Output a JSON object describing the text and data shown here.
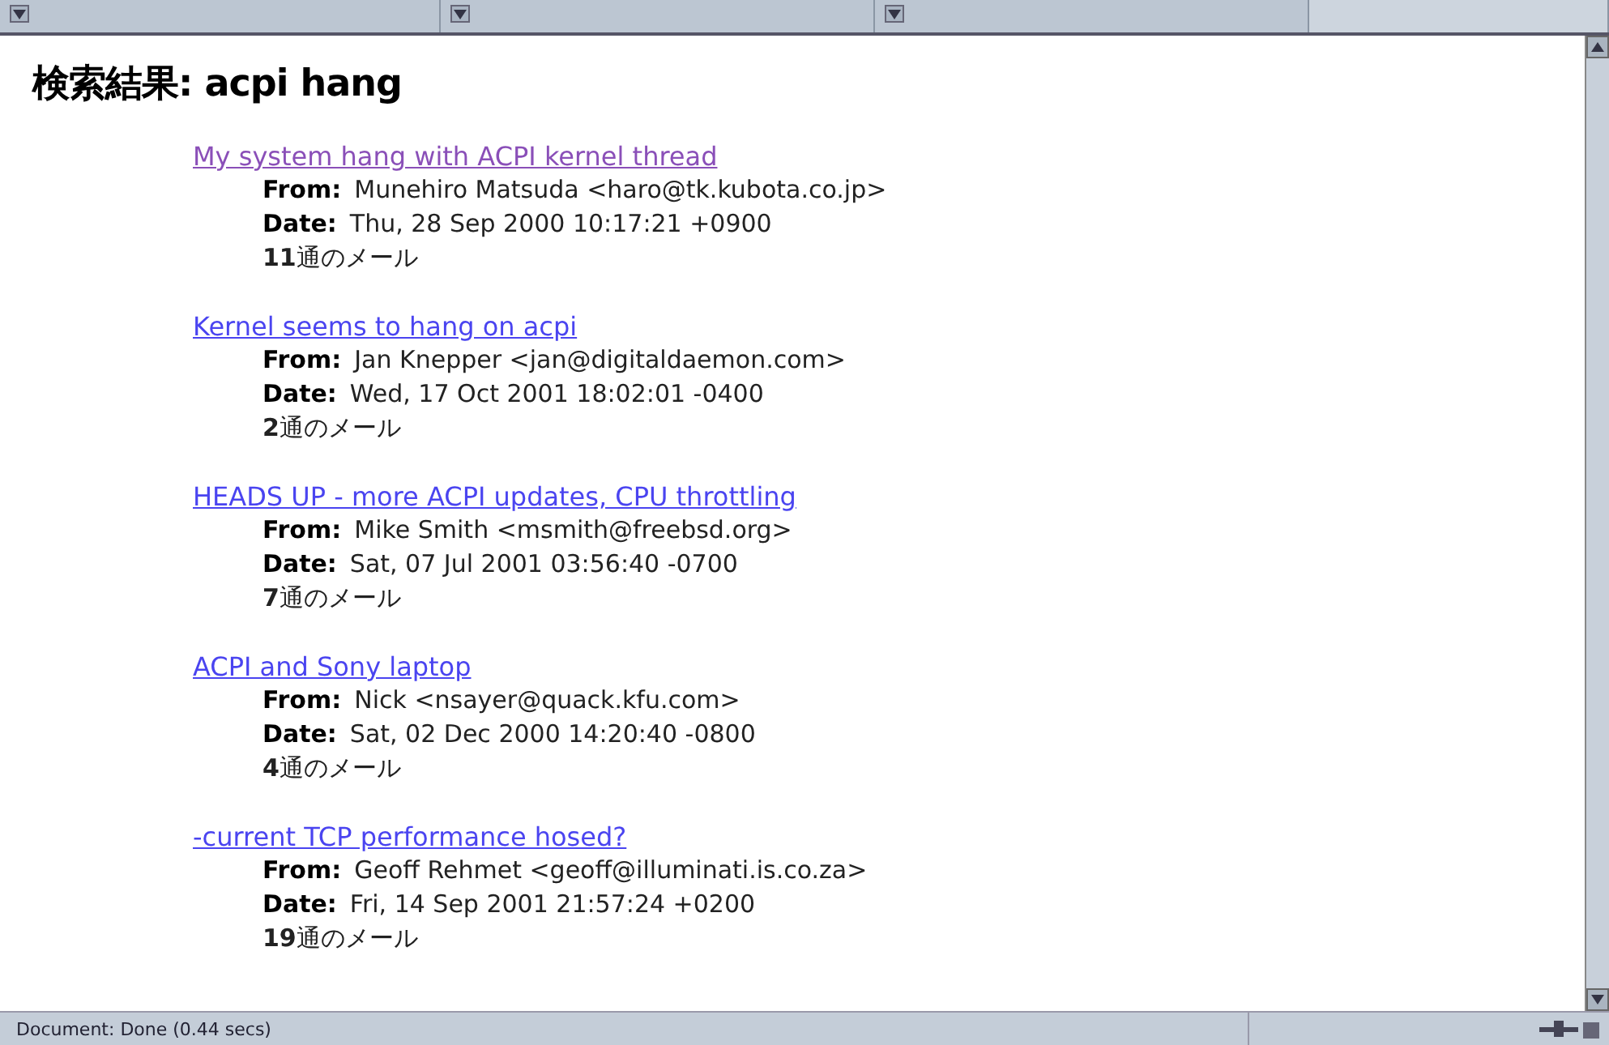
{
  "frame_bar": {
    "selectors": [
      {
        "kind": "dropdown"
      },
      {
        "kind": "dropdown"
      },
      {
        "kind": "dropdown"
      },
      {
        "kind": "plain"
      }
    ]
  },
  "heading": "検索結果: acpi hang",
  "results": [
    {
      "subject": "My system hang with ACPI kernel thread",
      "visited": true,
      "from_label": "From:",
      "from": "Munehiro Matsuda <haro@tk.kubota.co.jp>",
      "date_label": "Date:",
      "date": "Thu, 28 Sep 2000 10:17:21 +0900",
      "count": "**11**通のメール"
    },
    {
      "subject": "Kernel seems to hang on acpi",
      "visited": false,
      "from_label": "From:",
      "from": "Jan Knepper <jan@digitaldaemon.com>",
      "date_label": "Date:",
      "date": "Wed, 17 Oct 2001 18:02:01 -0400",
      "count": "**2**通のメール"
    },
    {
      "subject": "HEADS UP - more ACPI updates, CPU throttling",
      "visited": false,
      "from_label": "From:",
      "from": "Mike Smith <msmith@freebsd.org>",
      "date_label": "Date:",
      "date": "Sat, 07 Jul 2001 03:56:40 -0700",
      "count": "**7**通のメール"
    },
    {
      "subject": "ACPI and Sony laptop",
      "visited": false,
      "from_label": "From:",
      "from": "Nick <nsayer@quack.kfu.com>",
      "date_label": "Date:",
      "date": "Sat, 02 Dec 2000 14:20:40 -0800",
      "count": "**4**通のメール"
    },
    {
      "subject": "-current TCP performance hosed?",
      "visited": false,
      "from_label": "From:",
      "from": "Geoff Rehmet <geoff@illuminati.is.co.za>",
      "date_label": "Date:",
      "date": "Fri, 14 Sep 2001 21:57:24 +0200",
      "count": "**19**通のメール"
    }
  ],
  "status_bar": {
    "text": "Document: Done (0.44 secs)"
  }
}
